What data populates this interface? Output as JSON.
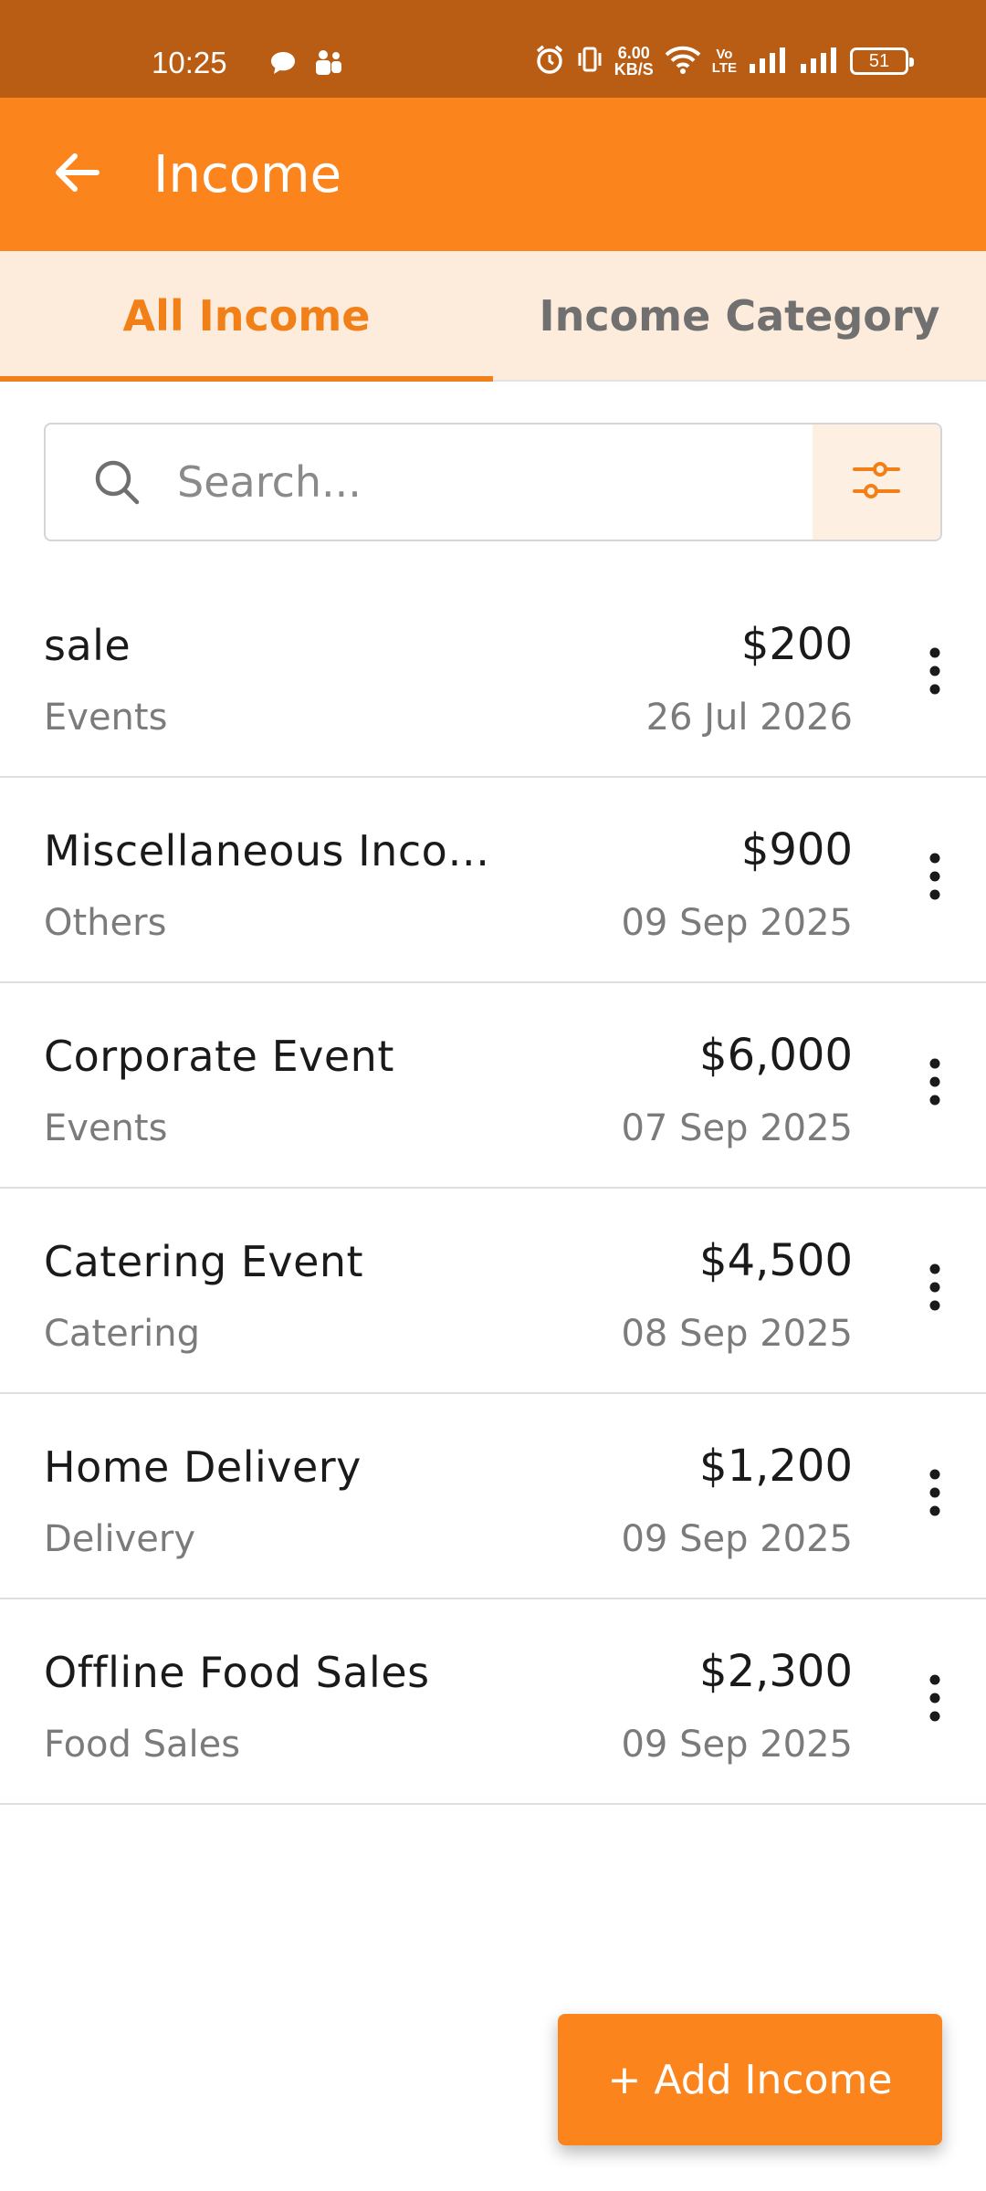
{
  "status_bar": {
    "time": "10:25",
    "net_speed_value": "6.00",
    "net_speed_unit": "KB/S",
    "volte_top": "Vo",
    "volte_bottom": "LTE",
    "battery": "51"
  },
  "app_bar": {
    "title": "Income"
  },
  "tabs": [
    {
      "label": "All Income",
      "active": true
    },
    {
      "label": "Income Category",
      "active": false
    }
  ],
  "search": {
    "placeholder": "Search..."
  },
  "incomes": [
    {
      "name": "sale",
      "category": "Events",
      "amount": "$200",
      "date": "26 Jul 2026"
    },
    {
      "name": "Miscellaneous Inco…",
      "category": "Others",
      "amount": "$900",
      "date": "09 Sep 2025"
    },
    {
      "name": "Corporate Event",
      "category": "Events",
      "amount": "$6,000",
      "date": "07 Sep 2025"
    },
    {
      "name": "Catering Event",
      "category": "Catering",
      "amount": "$4,500",
      "date": "08 Sep 2025"
    },
    {
      "name": "Home Delivery",
      "category": "Delivery",
      "amount": "$1,200",
      "date": "09 Sep 2025"
    },
    {
      "name": "Offline Food Sales",
      "category": "Food Sales",
      "amount": "$2,300",
      "date": "09 Sep 2025"
    }
  ],
  "fab": {
    "label": "+ Add Income"
  },
  "colors": {
    "primary": "#fc841d",
    "status_bar": "#b95c14",
    "tab_bg": "#fdecdc",
    "active_tab": "#f28019"
  }
}
